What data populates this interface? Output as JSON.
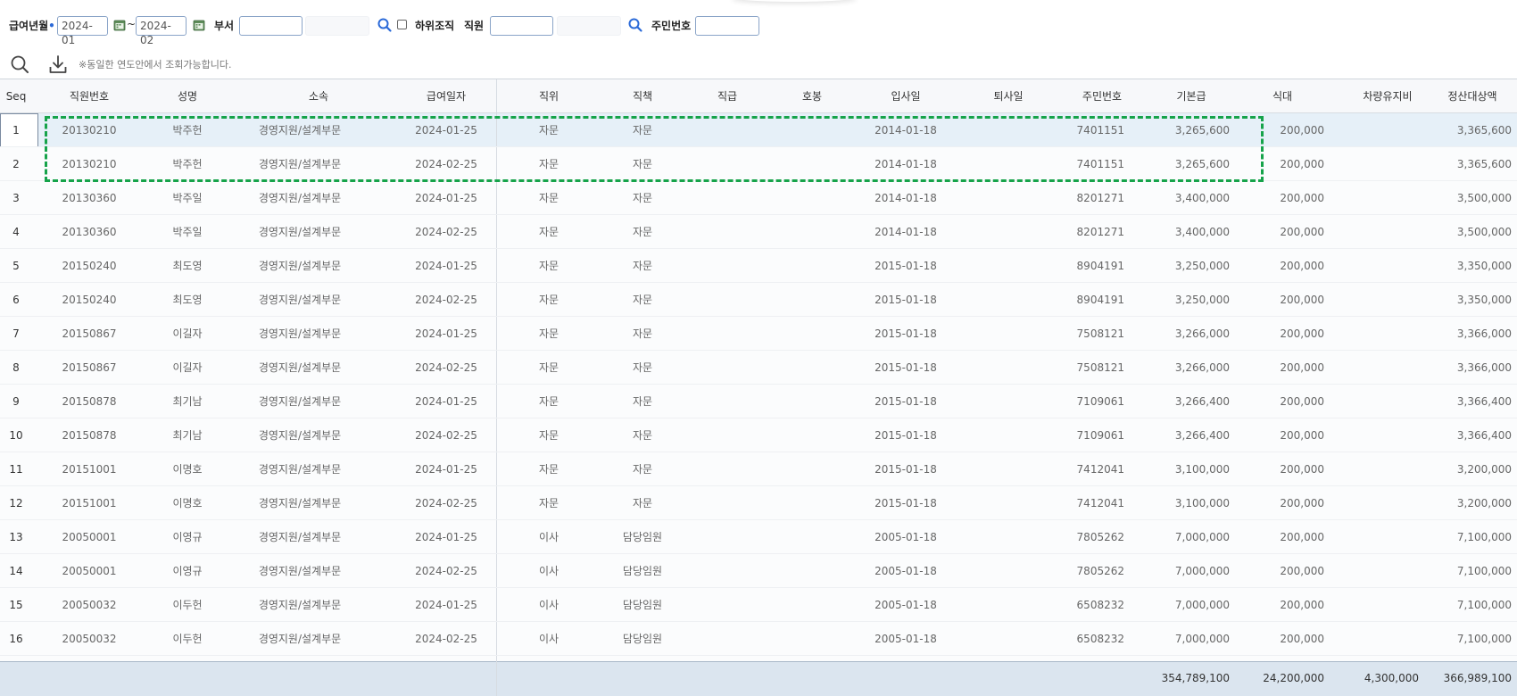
{
  "filters": {
    "pay_month_label": "급여년월",
    "required_mark": "•",
    "from_value": "2024-01",
    "to_value": "2024-02",
    "range_sep": "~",
    "dept_label": "부서",
    "dept_value": "",
    "include_sub_label": "하위조직",
    "include_sub_checked": false,
    "employee_label": "직원",
    "employee_value": "",
    "rrn_label": "주민번호",
    "rrn_value": ""
  },
  "toolbar": {
    "notice": "※동일한 연도안에서 조회가능합니다."
  },
  "grid": {
    "columns": [
      "Seq",
      "직원번호",
      "성명",
      "소속",
      "급여일자",
      "직위",
      "직책",
      "직급",
      "호봉",
      "입사일",
      "퇴사일",
      "주민번호",
      "기본급",
      "식대",
      "차량유지비",
      "정산대상액"
    ],
    "rows": [
      [
        "1",
        "20130210",
        "박주헌",
        "경영지원/설계부문",
        "2024-01-25",
        "자문",
        "자문",
        "",
        "",
        "2014-01-18",
        "",
        "7401151",
        "3,265,600",
        "200,000",
        "",
        "3,365,600"
      ],
      [
        "2",
        "20130210",
        "박주헌",
        "경영지원/설계부문",
        "2024-02-25",
        "자문",
        "자문",
        "",
        "",
        "2014-01-18",
        "",
        "7401151",
        "3,265,600",
        "200,000",
        "",
        "3,365,600"
      ],
      [
        "3",
        "20130360",
        "박주일",
        "경영지원/설계부문",
        "2024-01-25",
        "자문",
        "자문",
        "",
        "",
        "2014-01-18",
        "",
        "8201271",
        "3,400,000",
        "200,000",
        "",
        "3,500,000"
      ],
      [
        "4",
        "20130360",
        "박주일",
        "경영지원/설계부문",
        "2024-02-25",
        "자문",
        "자문",
        "",
        "",
        "2014-01-18",
        "",
        "8201271",
        "3,400,000",
        "200,000",
        "",
        "3,500,000"
      ],
      [
        "5",
        "20150240",
        "최도영",
        "경영지원/설계부문",
        "2024-01-25",
        "자문",
        "자문",
        "",
        "",
        "2015-01-18",
        "",
        "8904191",
        "3,250,000",
        "200,000",
        "",
        "3,350,000"
      ],
      [
        "6",
        "20150240",
        "최도영",
        "경영지원/설계부문",
        "2024-02-25",
        "자문",
        "자문",
        "",
        "",
        "2015-01-18",
        "",
        "8904191",
        "3,250,000",
        "200,000",
        "",
        "3,350,000"
      ],
      [
        "7",
        "20150867",
        "이길자",
        "경영지원/설계부문",
        "2024-01-25",
        "자문",
        "자문",
        "",
        "",
        "2015-01-18",
        "",
        "7508121",
        "3,266,000",
        "200,000",
        "",
        "3,366,000"
      ],
      [
        "8",
        "20150867",
        "이길자",
        "경영지원/설계부문",
        "2024-02-25",
        "자문",
        "자문",
        "",
        "",
        "2015-01-18",
        "",
        "7508121",
        "3,266,000",
        "200,000",
        "",
        "3,366,000"
      ],
      [
        "9",
        "20150878",
        "최기남",
        "경영지원/설계부문",
        "2024-01-25",
        "자문",
        "자문",
        "",
        "",
        "2015-01-18",
        "",
        "7109061",
        "3,266,400",
        "200,000",
        "",
        "3,366,400"
      ],
      [
        "10",
        "20150878",
        "최기남",
        "경영지원/설계부문",
        "2024-02-25",
        "자문",
        "자문",
        "",
        "",
        "2015-01-18",
        "",
        "7109061",
        "3,266,400",
        "200,000",
        "",
        "3,366,400"
      ],
      [
        "11",
        "20151001",
        "이명호",
        "경영지원/설계부문",
        "2024-01-25",
        "자문",
        "자문",
        "",
        "",
        "2015-01-18",
        "",
        "7412041",
        "3,100,000",
        "200,000",
        "",
        "3,200,000"
      ],
      [
        "12",
        "20151001",
        "이명호",
        "경영지원/설계부문",
        "2024-02-25",
        "자문",
        "자문",
        "",
        "",
        "2015-01-18",
        "",
        "7412041",
        "3,100,000",
        "200,000",
        "",
        "3,200,000"
      ],
      [
        "13",
        "20050001",
        "이영규",
        "경영지원/설계부문",
        "2024-01-25",
        "이사",
        "담당임원",
        "",
        "",
        "2005-01-18",
        "",
        "7805262",
        "7,000,000",
        "200,000",
        "",
        "7,100,000"
      ],
      [
        "14",
        "20050001",
        "이영규",
        "경영지원/설계부문",
        "2024-02-25",
        "이사",
        "담당임원",
        "",
        "",
        "2005-01-18",
        "",
        "7805262",
        "7,000,000",
        "200,000",
        "",
        "7,100,000"
      ],
      [
        "15",
        "20050032",
        "이두헌",
        "경영지원/설계부문",
        "2024-01-25",
        "이사",
        "담당임원",
        "",
        "",
        "2005-01-18",
        "",
        "6508232",
        "7,000,000",
        "200,000",
        "",
        "7,100,000"
      ],
      [
        "16",
        "20050032",
        "이두헌",
        "경영지원/설계부문",
        "2024-02-25",
        "이사",
        "담당임원",
        "",
        "",
        "2005-01-18",
        "",
        "6508232",
        "7,000,000",
        "200,000",
        "",
        "7,100,000"
      ]
    ],
    "selected_row": 1,
    "summary": {
      "base_pay": "354,789,100",
      "meal": "24,200,000",
      "vehicle": "4,300,000",
      "settlement": "366,989,100"
    }
  },
  "colors": {
    "accent": "#2b6ad8",
    "highlight_border": "#16a34a",
    "selected_row": "#e6f0f8",
    "summary_bg": "#dbe5ef"
  }
}
